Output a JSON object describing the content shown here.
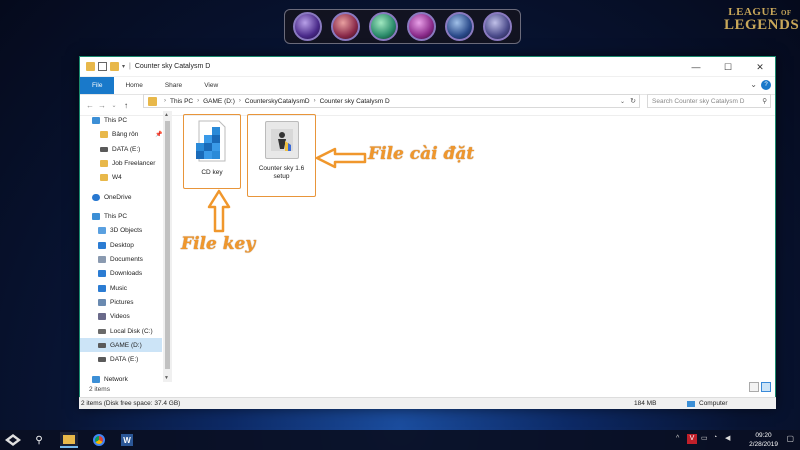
{
  "desktop": {
    "logo_line1": "LEAGUE",
    "logo_of": "OF",
    "logo_line2": "LEGENDS"
  },
  "window": {
    "title": "Counter sky Catalysm D",
    "controls": {
      "minimize": "—",
      "maximize": "☐",
      "close": "✕"
    }
  },
  "ribbon": {
    "tabs": [
      "File",
      "Home",
      "Share",
      "View"
    ],
    "expand": "⌄",
    "help": "?"
  },
  "address": {
    "crumbs": [
      "This PC",
      "GAME (D:)",
      "CounterskyCatalysmD",
      "Counter sky Catalysm D"
    ],
    "search_placeholder": "Search Counter sky Catalysm D"
  },
  "sidebar": {
    "items": [
      {
        "label": "This PC",
        "icon": "pc-icon",
        "color": "#3c8fd6"
      },
      {
        "label": "Bảng rôn",
        "icon": "folder-icon",
        "color": "#e8b84a",
        "pinned": true
      },
      {
        "label": "DATA (E:)",
        "icon": "drive-icon",
        "color": "#5a5a5a"
      },
      {
        "label": "Job Freelancer",
        "icon": "folder-icon",
        "color": "#e8b84a"
      },
      {
        "label": "W4",
        "icon": "folder-icon",
        "color": "#e8b84a"
      },
      {
        "label": "OneDrive",
        "icon": "cloud-icon",
        "color": "#2878d0"
      },
      {
        "label": "This PC",
        "icon": "pc-icon",
        "color": "#3c8fd6"
      },
      {
        "label": "3D Objects",
        "icon": "cube-icon",
        "color": "#5aa0e0"
      },
      {
        "label": "Desktop",
        "icon": "desktop-icon",
        "color": "#2b7cd3"
      },
      {
        "label": "Documents",
        "icon": "document-icon",
        "color": "#8a9ab0"
      },
      {
        "label": "Downloads",
        "icon": "download-icon",
        "color": "#2b7cd3"
      },
      {
        "label": "Music",
        "icon": "music-icon",
        "color": "#2b7cd3"
      },
      {
        "label": "Pictures",
        "icon": "picture-icon",
        "color": "#6a8ab0"
      },
      {
        "label": "Videos",
        "icon": "video-icon",
        "color": "#6a6a8a"
      },
      {
        "label": "Local Disk (C:)",
        "icon": "windows-drive-icon",
        "color": "#6a6a6a"
      },
      {
        "label": "GAME (D:)",
        "icon": "drive-icon",
        "color": "#5a5a5a",
        "selected": true
      },
      {
        "label": "DATA (E:)",
        "icon": "drive-icon",
        "color": "#5a5a5a"
      },
      {
        "label": "Network",
        "icon": "network-icon",
        "color": "#3c8fd6"
      }
    ]
  },
  "files": [
    {
      "name": "CD key",
      "icon": "registry-icon"
    },
    {
      "name": "Counter sky 1.6 setup",
      "icon": "counter-strike-icon"
    }
  ],
  "annotations": {
    "setup": "File cài đặt",
    "key": "File key",
    "color": "#f0972c"
  },
  "status": {
    "items_count": "2 items",
    "bar_left": "2 items (Disk free space: 37.4 GB)",
    "size": "184 MB",
    "location": "Computer"
  },
  "taskbar": {
    "time": "09:20",
    "date": "2/28/2019"
  }
}
